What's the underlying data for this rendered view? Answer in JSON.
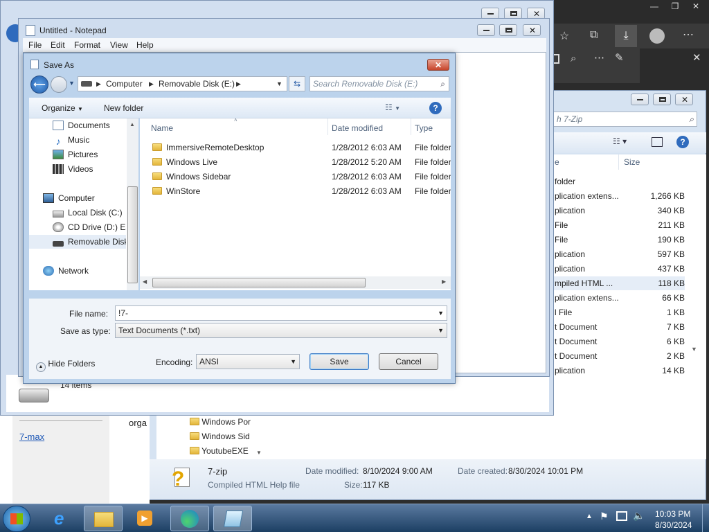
{
  "browser": {
    "top_controls": [
      "—",
      "❐",
      "✕"
    ]
  },
  "zip_window": {
    "search_placeholder": "h 7-Zip",
    "col_size": "Size",
    "rows": [
      {
        "type": " folder",
        "size": ""
      },
      {
        "type": "plication extens...",
        "size": "1,266 KB"
      },
      {
        "type": "plication",
        "size": "340 KB"
      },
      {
        "type": " File",
        "size": "211 KB"
      },
      {
        "type": " File",
        "size": "190 KB"
      },
      {
        "type": "plication",
        "size": "597 KB"
      },
      {
        "type": "plication",
        "size": "437 KB"
      },
      {
        "type": "mpiled HTML ...",
        "size": "118 KB"
      },
      {
        "type": "plication extens...",
        "size": "66 KB"
      },
      {
        "type": "l File",
        "size": "1 KB"
      },
      {
        "type": "t Document",
        "size": "7 KB"
      },
      {
        "type": "t Document",
        "size": "6 KB"
      },
      {
        "type": "t Document",
        "size": "2 KB"
      },
      {
        "type": "plication",
        "size": "14 KB"
      }
    ],
    "tree": [
      "Windows Por",
      "Windows Sid",
      "YoutubeEXE"
    ],
    "details": {
      "name": "7-zip",
      "kind": "Compiled HTML Help file",
      "modified_label": "Date modified:",
      "modified": "8/10/2024 9:00 AM",
      "created_label": "Date created:",
      "created": "8/30/2024 10:01 PM",
      "size_label": "Size:",
      "size": "117 KB"
    }
  },
  "background_page": {
    "link": "7-max",
    "text": "orga",
    "items_count": "14 items"
  },
  "notepad": {
    "title": "Untitled - Notepad",
    "menu": [
      "File",
      "Edit",
      "Format",
      "View",
      "Help"
    ]
  },
  "save_dialog": {
    "title": "Save As",
    "breadcrumb": [
      "Computer",
      "Removable Disk (E:)"
    ],
    "search_placeholder": "Search Removable Disk (E:)",
    "organize": "Organize",
    "new_folder": "New folder",
    "tree": [
      {
        "label": "Documents",
        "icon": "documents-icon"
      },
      {
        "label": "Music",
        "icon": "music-icon"
      },
      {
        "label": "Pictures",
        "icon": "pictures-icon"
      },
      {
        "label": "Videos",
        "icon": "videos-icon"
      },
      {
        "label": "Computer",
        "icon": "computer-icon"
      },
      {
        "label": "Local Disk (C:)",
        "icon": "drive-icon"
      },
      {
        "label": "CD Drive (D:) Eas",
        "icon": "cd-drive-icon"
      },
      {
        "label": "Removable Disk (E:)",
        "icon": "usb-drive-icon"
      },
      {
        "label": "Network",
        "icon": "network-icon"
      }
    ],
    "columns": {
      "name": "Name",
      "date": "Date modified",
      "type": "Type"
    },
    "files": [
      {
        "name": "ImmersiveRemoteDesktop",
        "date": "1/28/2012 6:03 AM",
        "type": "File folder"
      },
      {
        "name": "Windows Live",
        "date": "1/28/2012 5:20 AM",
        "type": "File folder"
      },
      {
        "name": "Windows Sidebar",
        "date": "1/28/2012 6:03 AM",
        "type": "File folder"
      },
      {
        "name": "WinStore",
        "date": "1/28/2012 6:03 AM",
        "type": "File folder"
      }
    ],
    "file_name_label": "File name:",
    "file_name_value": "!7-",
    "save_type_label": "Save as type:",
    "save_type_value": "Text Documents (*.txt)",
    "hide_folders": "Hide Folders",
    "encoding_label": "Encoding:",
    "encoding_value": "ANSI",
    "save": "Save",
    "cancel": "Cancel"
  },
  "taskbar": {
    "time": "10:03 PM",
    "date": "8/30/2024"
  },
  "colors": {
    "taskbar": "#1c3f63",
    "dialog_frame": "#bcd3ec",
    "accent": "#3b79c4"
  }
}
